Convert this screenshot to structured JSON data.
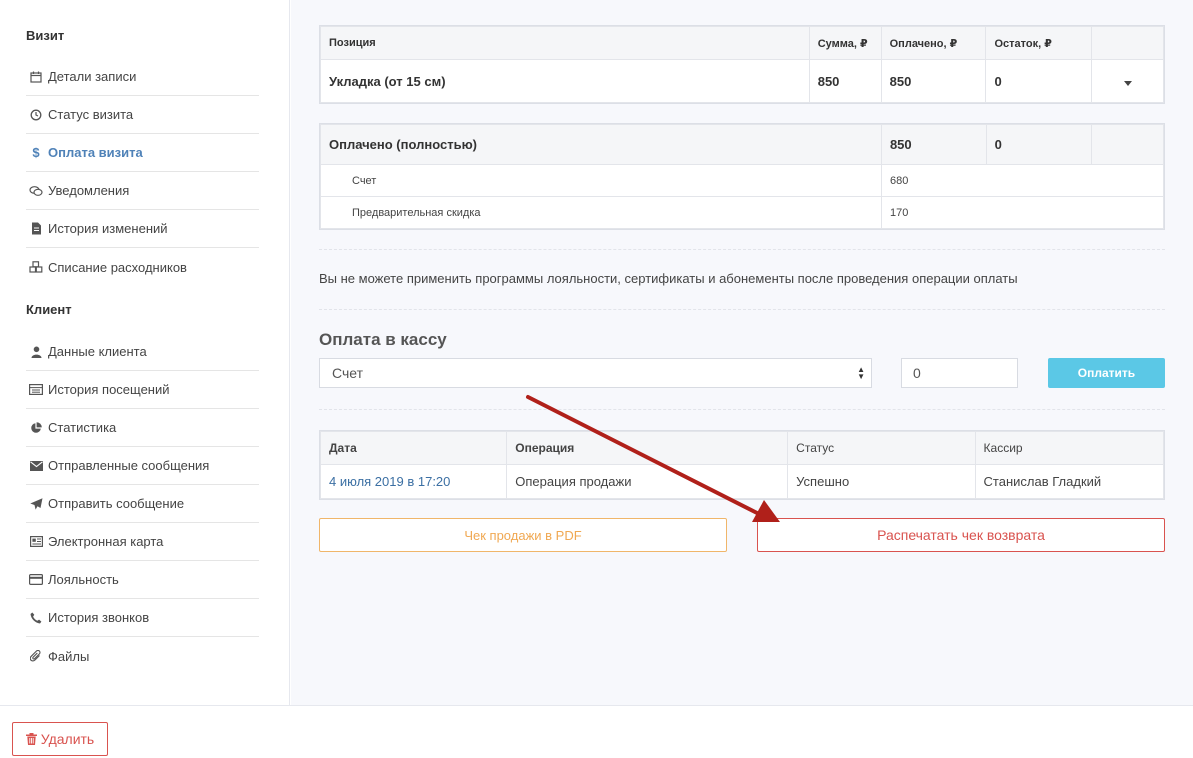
{
  "sidebar": {
    "visit_heading": "Визит",
    "visit_items": [
      {
        "label": "Детали записи",
        "icon": "calendar-icon"
      },
      {
        "label": "Статус визита",
        "icon": "clock-icon"
      },
      {
        "label": "Оплата визита",
        "icon": "dollar-icon",
        "active": true
      },
      {
        "label": "Уведомления",
        "icon": "comments-icon"
      },
      {
        "label": "История изменений",
        "icon": "document-icon"
      },
      {
        "label": "Списание расходников",
        "icon": "cubes-icon"
      }
    ],
    "client_heading": "Клиент",
    "client_items": [
      {
        "label": "Данные клиента",
        "icon": "user-icon"
      },
      {
        "label": "История посещений",
        "icon": "list-icon"
      },
      {
        "label": "Статистика",
        "icon": "pie-chart-icon"
      },
      {
        "label": "Отправленные сообщения",
        "icon": "envelope-icon"
      },
      {
        "label": "Отправить сообщение",
        "icon": "paper-plane-icon"
      },
      {
        "label": "Электронная карта",
        "icon": "card-icon"
      },
      {
        "label": "Лояльность",
        "icon": "credit-card-icon"
      },
      {
        "label": "История звонков",
        "icon": "phone-icon"
      },
      {
        "label": "Файлы",
        "icon": "paperclip-icon"
      }
    ]
  },
  "positions_table": {
    "headers": [
      "Позиция",
      "Сумма, ₽",
      "Оплачено, ₽",
      "Остаток, ₽"
    ],
    "rows": [
      {
        "name": "Укладка (от 15 см)",
        "sum": "850",
        "paid": "850",
        "rest": "0"
      }
    ]
  },
  "payment_summary": {
    "label": "Оплачено (полностью)",
    "paid": "850",
    "rest": "0",
    "details": [
      {
        "label": "Счет",
        "value": "680"
      },
      {
        "label": "Предварительная скидка",
        "value": "170"
      }
    ]
  },
  "notice": "Вы не можете применить программы лояльности, сертификаты и абонементы после проведения операции оплаты",
  "cash_payment": {
    "title": "Оплата в кассу",
    "selected_account": "Счет",
    "amount": "0",
    "pay_label": "Оплатить"
  },
  "operations_table": {
    "headers": [
      "Дата",
      "Операция",
      "Статус",
      "Кассир"
    ],
    "rows": [
      {
        "date": "4 июля 2019 в 17:20",
        "operation": "Операция продажи",
        "status": "Успешно",
        "cashier": "Станислав Гладкий"
      }
    ]
  },
  "actions": {
    "pdf_label": "Чек продажи в PDF",
    "refund_label": "Распечатать чек возврата"
  },
  "footer": {
    "delete_label": "Удалить"
  },
  "colors": {
    "accent_blue": "#4f82b8",
    "pay_button": "#5bc8e6",
    "danger": "#d9534f",
    "warning": "#f0a852",
    "annotation_arrow": "#b0201a"
  }
}
